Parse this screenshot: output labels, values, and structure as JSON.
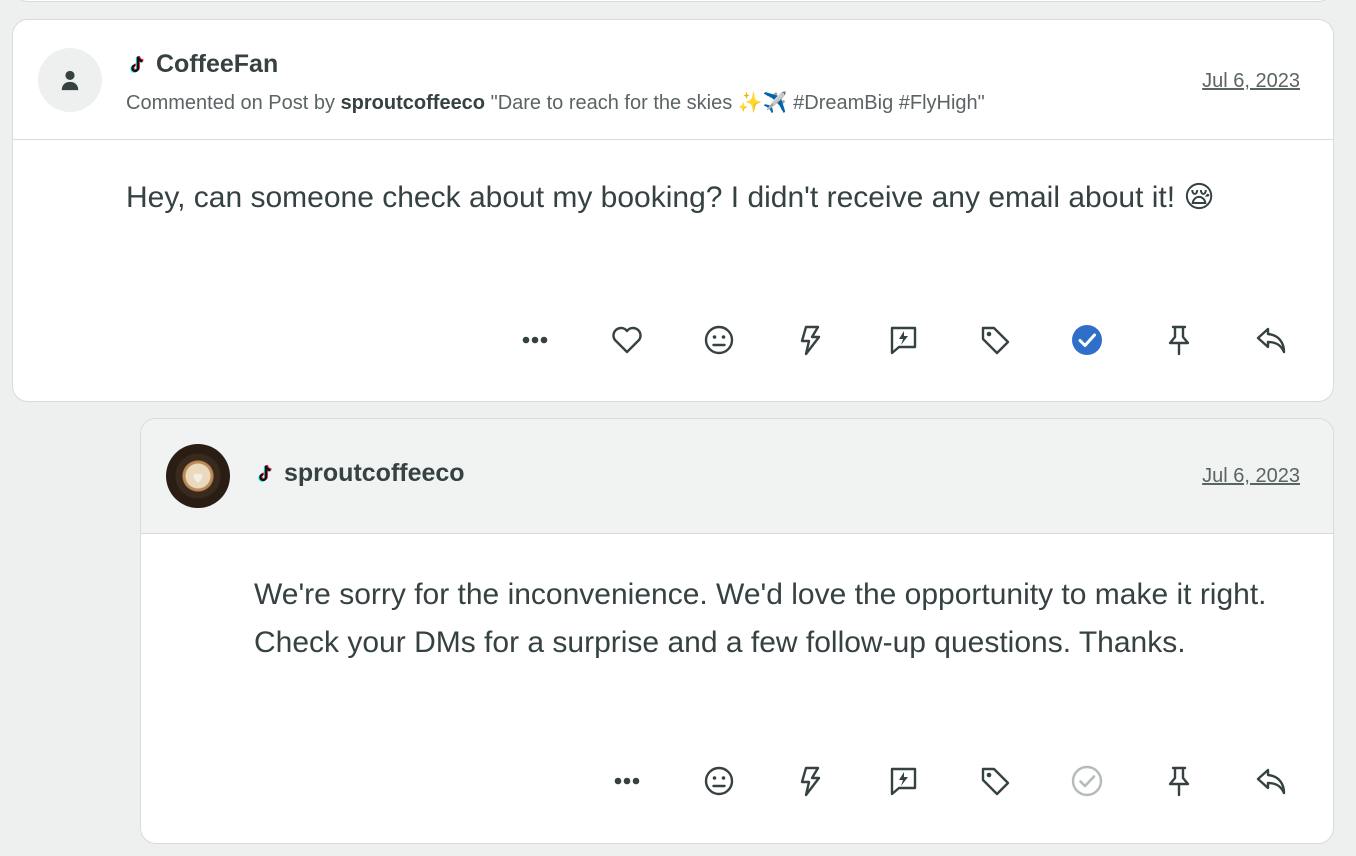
{
  "comment": {
    "author": "CoffeeFan",
    "context_prefix": "Commented on Post by",
    "context_account": "sproutcoffeeco",
    "context_post": "\"Dare to reach for the skies ✨✈️ #DreamBig #FlyHigh\"",
    "date": "Jul 6, 2023",
    "text": "Hey, can someone check about my booking? I didn't receive any email about it! 😪",
    "actions": [
      "more-icon",
      "heart-icon",
      "sentiment-icon",
      "bolt-icon",
      "quick-reply-icon",
      "tag-icon",
      "complete-icon",
      "pin-icon",
      "reply-icon"
    ],
    "complete_color": "#2f6fc9"
  },
  "reply": {
    "author": "sproutcoffeeco",
    "date": "Jul 6, 2023",
    "text": "We're sorry for the inconvenience. We'd love the opportunity to make it right. Check your DMs for a surprise and a few follow-up questions. Thanks.",
    "actions": [
      "more-icon",
      "sentiment-icon",
      "bolt-icon",
      "quick-reply-icon",
      "tag-icon",
      "complete-icon",
      "pin-icon",
      "reply-icon"
    ],
    "complete_color": "#b5baba"
  }
}
